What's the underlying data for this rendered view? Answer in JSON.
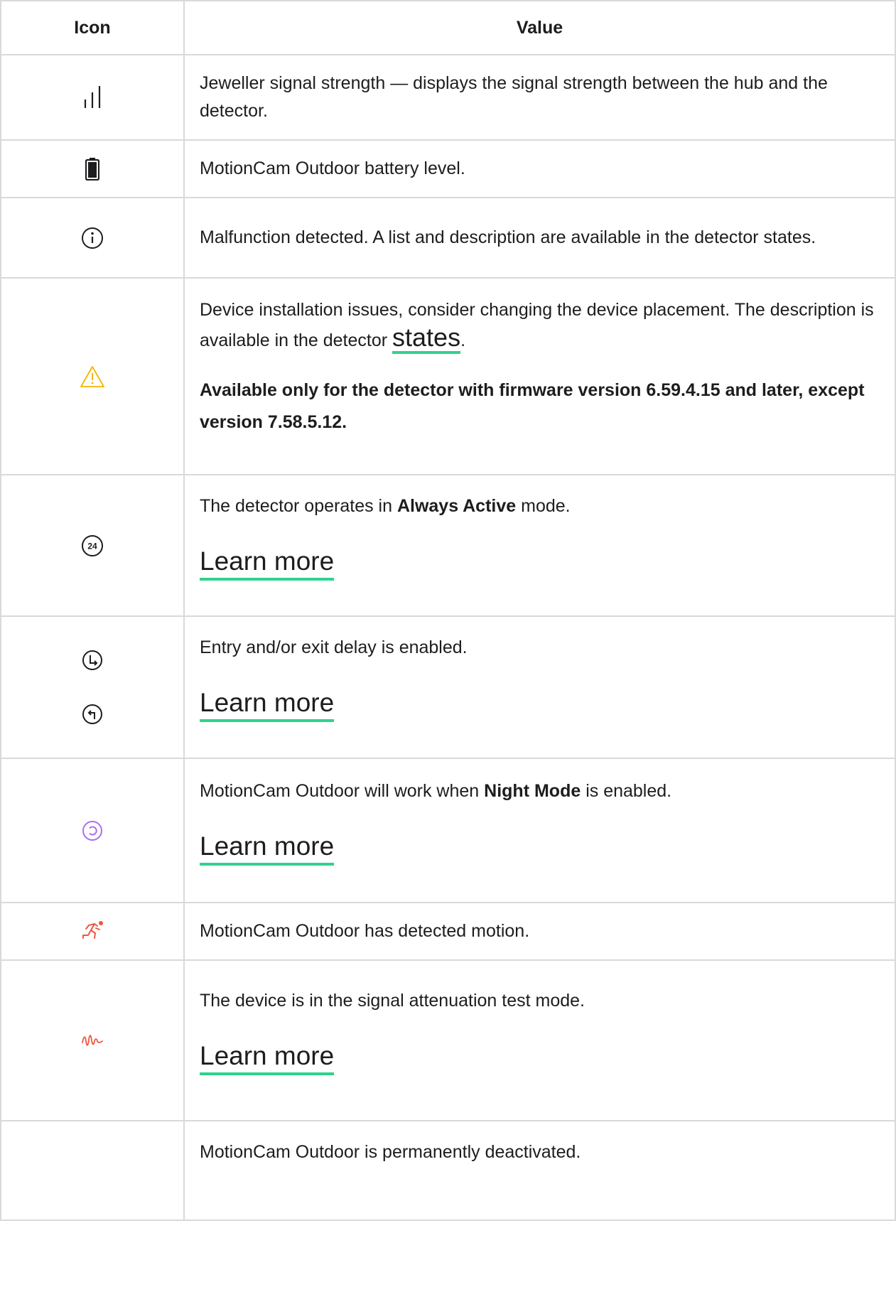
{
  "table": {
    "headers": {
      "icon": "Icon",
      "value": "Value"
    },
    "rows": {
      "signal": {
        "icon": "signal-strength-icon",
        "text": "Jeweller signal strength — displays the signal strength between the hub and the detector."
      },
      "battery": {
        "icon": "battery-icon",
        "text": "MotionCam Outdoor battery level."
      },
      "malfunction": {
        "icon": "info-icon",
        "text": "Malfunction detected. A list and description are available in the detector states."
      },
      "installation": {
        "icon": "warning-icon",
        "text_before": "Device installation issues, consider changing the device placement. The description is available in the detector ",
        "link": "states",
        "text_after": ".",
        "note": "Available only for the detector with firmware version 6.59.4.15 and later, except version 7.58.5.12."
      },
      "always_active": {
        "icon": "always-active-24-icon",
        "icon_text": "24",
        "text_before": "The detector operates in ",
        "bold": "Always Active",
        "text_after": " mode.",
        "link": "Learn more"
      },
      "delay": {
        "icons": [
          "entry-delay-icon",
          "exit-delay-icon"
        ],
        "text": "Entry and/or exit delay is enabled.",
        "link": "Learn more"
      },
      "night_mode": {
        "icon": "night-mode-icon",
        "text_before": "MotionCam Outdoor will work when ",
        "bold": "Night Mode",
        "text_after": " is enabled.",
        "link": "Learn more"
      },
      "motion": {
        "icon": "motion-detected-icon",
        "text": "MotionCam Outdoor has detected motion."
      },
      "attenuation": {
        "icon": "signal-attenuation-icon",
        "text": "The device is in the signal attenuation test mode.",
        "link": "Learn more"
      },
      "deactivated": {
        "icon": "deactivated-icon",
        "text": "MotionCam Outdoor is permanently deactivated."
      }
    }
  },
  "colors": {
    "border": "#d9d9d9",
    "link_underline": "#2fd28c",
    "warning": "#f5b400",
    "night_mode": "#a970f5",
    "alert_red": "#f0553f",
    "text": "#1d1d1f"
  }
}
